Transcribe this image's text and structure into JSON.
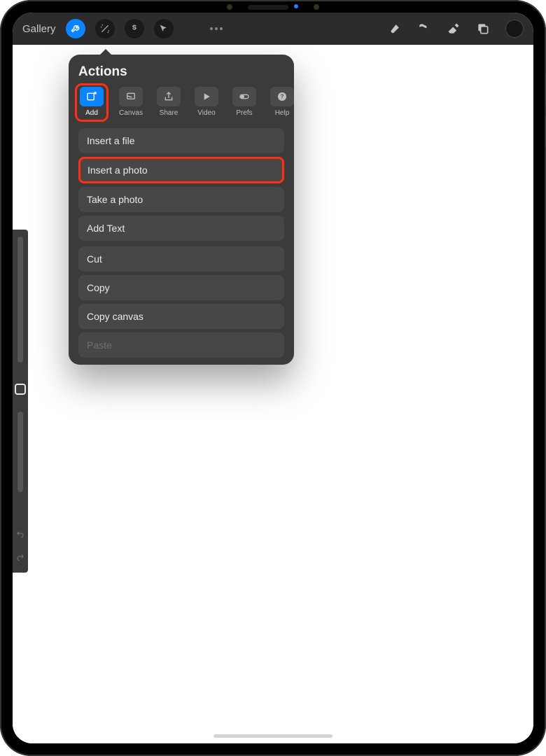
{
  "toolbar": {
    "gallery_label": "Gallery"
  },
  "popup": {
    "title": "Actions",
    "tabs": [
      {
        "label": "Add"
      },
      {
        "label": "Canvas"
      },
      {
        "label": "Share"
      },
      {
        "label": "Video"
      },
      {
        "label": "Prefs"
      },
      {
        "label": "Help"
      }
    ],
    "group1": [
      "Insert a file",
      "Insert a photo",
      "Take a photo",
      "Add Text"
    ],
    "group2": [
      "Cut",
      "Copy",
      "Copy canvas",
      "Paste"
    ]
  },
  "highlight_color": "#ff2e17",
  "accent_color": "#0a84ff"
}
